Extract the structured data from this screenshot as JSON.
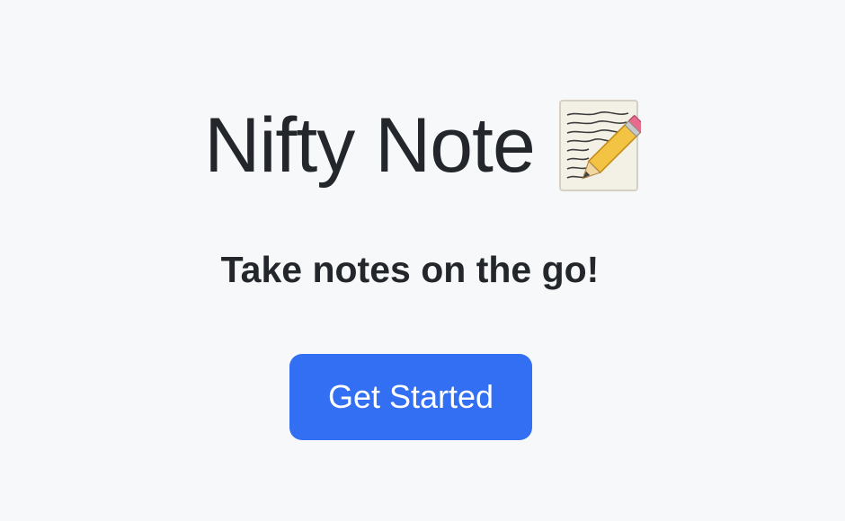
{
  "hero": {
    "title": "Nifty Note",
    "title_icon": "memo-pencil-icon",
    "subtitle": "Take notes on the go!",
    "cta_label": "Get Started"
  },
  "colors": {
    "background": "#f7f8fa",
    "text": "#23272b",
    "button": "#326ff2",
    "button_text": "#ffffff"
  }
}
